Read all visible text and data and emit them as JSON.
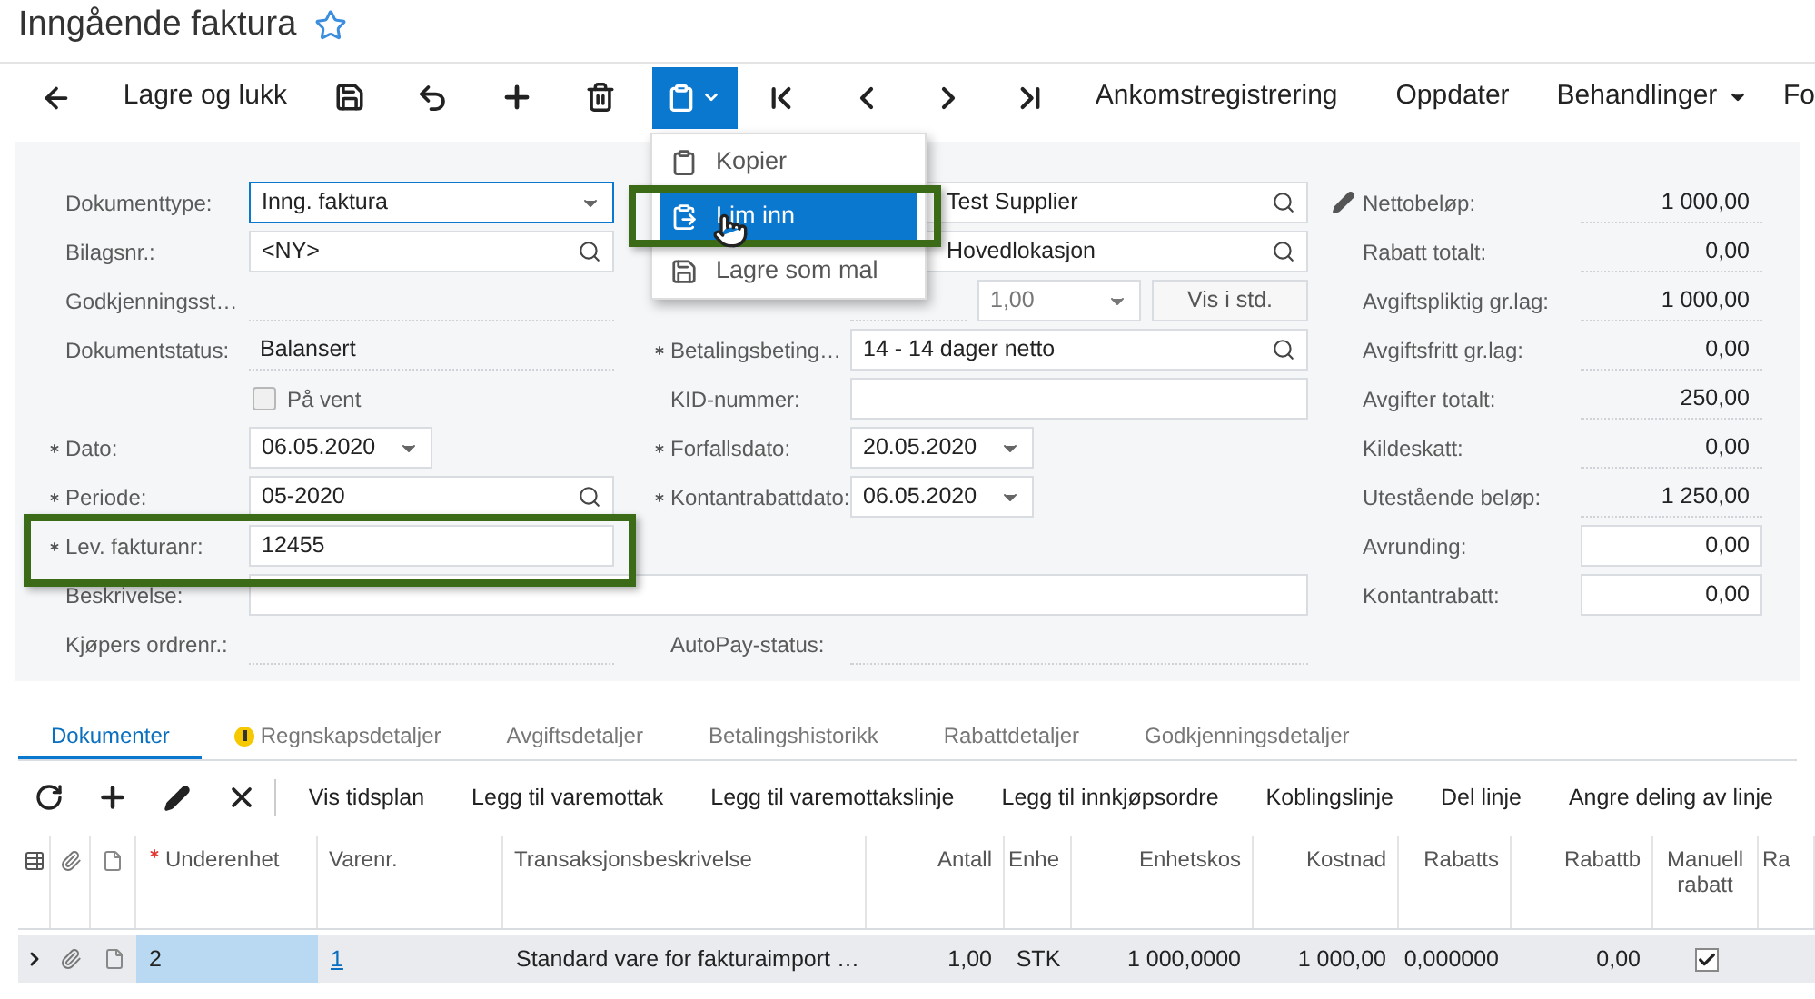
{
  "title": "Inngående faktura",
  "toolbar": {
    "save_close": "Lagre og lukk",
    "clipboard_button": {
      "selected": true
    },
    "actions": [
      "Ankomstregistrering",
      "Oppdater"
    ],
    "menu": "Behandlinger",
    "cut_item": "Fo"
  },
  "clipboard_menu": {
    "items": [
      {
        "label": "Kopier",
        "selected": false
      },
      {
        "label": "Lim inn",
        "selected": true,
        "highlighted": true
      },
      {
        "label": "Lagre som mal",
        "selected": false
      }
    ]
  },
  "left_fields": [
    {
      "kind": "select",
      "label": "Dokumenttype:",
      "value": "Inng. faktura",
      "focused": true
    },
    {
      "kind": "search",
      "label": "Bilagsnr.:",
      "value": "<NY>"
    },
    {
      "kind": "readonly",
      "label": "Godkjenningsst…"
    },
    {
      "kind": "readonly",
      "label": "Dokumentstatus:",
      "value": "Balansert"
    },
    {
      "kind": "checkbox",
      "label": "På vent",
      "checked": false
    },
    {
      "kind": "date",
      "label": "Dato:",
      "required": true,
      "value": "06.05.2020"
    },
    {
      "kind": "search",
      "label": "Periode:",
      "required": true,
      "value": "05-2020"
    },
    {
      "kind": "text",
      "label": "Lev. fakturanr:",
      "required": true,
      "value": "12455",
      "highlighted": true
    },
    {
      "kind": "wide",
      "label": "Beskrivelse:"
    },
    {
      "kind": "readonly",
      "label": "Kjøpers ordrenr.:"
    }
  ],
  "middle_fields": [
    {
      "kind": "search",
      "value": "Test Supplier"
    },
    {
      "kind": "search",
      "value": "Hovedlokasjon"
    },
    {
      "kind": "currency",
      "rate": "1,00",
      "button": "Vis i std."
    },
    {
      "kind": "search",
      "label": "Betalingsbeting…",
      "required": true,
      "value": "14 - 14 dager netto"
    },
    {
      "kind": "text",
      "label": "KID-nummer:"
    },
    {
      "kind": "date",
      "label": "Forfallsdato:",
      "required": true,
      "value": "20.05.2020"
    },
    {
      "kind": "date",
      "label": "Kontantrabattdato:",
      "required": true,
      "value": "06.05.2020"
    }
  ],
  "autopay": {
    "label": "AutoPay-status:"
  },
  "totals": [
    {
      "kind": "readonly",
      "label": "Nettobeløp:",
      "value": "1 000,00"
    },
    {
      "kind": "readonly",
      "label": "Rabatt totalt:",
      "value": "0,00"
    },
    {
      "kind": "readonly",
      "label": "Avgiftspliktig gr.lag:",
      "value": "1 000,00"
    },
    {
      "kind": "readonly",
      "label": "Avgiftsfritt gr.lag:",
      "value": "0,00"
    },
    {
      "kind": "readonly",
      "label": "Avgifter totalt:",
      "value": "250,00"
    },
    {
      "kind": "readonly",
      "label": "Kildeskatt:",
      "value": "0,00"
    },
    {
      "kind": "readonly",
      "label": "Utestående beløp:",
      "value": "1 250,00"
    },
    {
      "kind": "input",
      "label": "Avrunding:",
      "value": "0,00"
    },
    {
      "kind": "input",
      "label": "Kontantrabatt:",
      "value": "0,00"
    }
  ],
  "tabs": [
    {
      "label": "Dokumenter",
      "selected": true,
      "warning": false
    },
    {
      "label": "Regnskapsdetaljer",
      "selected": false,
      "warning": true
    },
    {
      "label": "Avgiftsdetaljer",
      "selected": false,
      "warning": false
    },
    {
      "label": "Betalingshistorikk",
      "selected": false,
      "warning": false
    },
    {
      "label": "Rabattdetaljer",
      "selected": false,
      "warning": false
    },
    {
      "label": "Godkjenningsdetaljer",
      "selected": false,
      "warning": false
    }
  ],
  "grid_actions": [
    "Vis tidsplan",
    "Legg til varemottak",
    "Legg til varemottakslinje",
    "Legg til innkjøpsordre",
    "Koblingslinje",
    "Del linje",
    "Angre deling av linje"
  ],
  "table": {
    "columns": [
      {
        "label": "Underenhet",
        "required": true
      },
      {
        "label": "Varenr."
      },
      {
        "label": "Transaksjonsbeskrivelse"
      },
      {
        "label": "Antall"
      },
      {
        "label": "Enhe"
      },
      {
        "label": "Enhetskos"
      },
      {
        "label": "Kostnad"
      },
      {
        "label": "Rabatts"
      },
      {
        "label": "Rabattb"
      },
      {
        "label": "Manuell rabatt"
      },
      {
        "label": "Ra"
      }
    ],
    "rows": [
      {
        "cells": [
          "2",
          "1",
          "Standard vare for fakturaimport …",
          "1,00",
          "STK",
          "1 000,0000",
          "1 000,00",
          "0,000000",
          "0,00"
        ],
        "manual_discount": true
      }
    ]
  }
}
